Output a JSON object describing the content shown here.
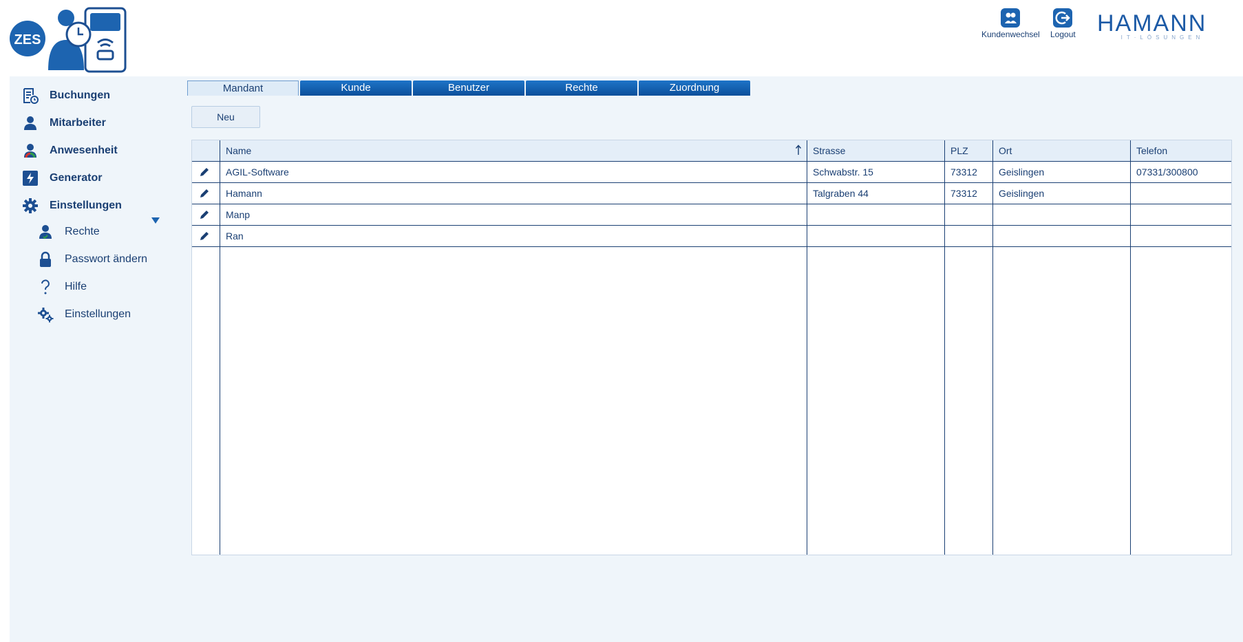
{
  "header": {
    "logo_text": "ZES",
    "kundenwechsel_label": "Kundenwechsel",
    "logout_label": "Logout",
    "brand_name": "HAMANN",
    "brand_sub": "IT·LÖSUNGEN"
  },
  "sidebar": {
    "items": [
      {
        "label": "Buchungen",
        "icon": "bookings-icon"
      },
      {
        "label": "Mitarbeiter",
        "icon": "person-icon"
      },
      {
        "label": "Anwesenheit",
        "icon": "presence-icon"
      },
      {
        "label": "Generator",
        "icon": "lightning-icon"
      },
      {
        "label": "Einstellungen",
        "icon": "gear-icon"
      }
    ],
    "subitems": [
      {
        "label": "Rechte",
        "icon": "person-check-icon"
      },
      {
        "label": "Passwort ändern",
        "icon": "lock-icon"
      },
      {
        "label": "Hilfe",
        "icon": "question-icon"
      },
      {
        "label": "Einstellungen",
        "icon": "gears-icon"
      }
    ]
  },
  "tabs": [
    {
      "label": "Mandant",
      "active": true
    },
    {
      "label": "Kunde",
      "active": false
    },
    {
      "label": "Benutzer",
      "active": false
    },
    {
      "label": "Rechte",
      "active": false
    },
    {
      "label": "Zuordnung",
      "active": false
    }
  ],
  "toolbar": {
    "new_label": "Neu"
  },
  "table": {
    "columns": [
      "Name",
      "Strasse",
      "PLZ",
      "Ort",
      "Telefon"
    ],
    "sort_column": "Name",
    "sort_direction": "ascending",
    "rows": [
      [
        "AGIL-Software",
        "Schwabstr. 15",
        "73312",
        "Geislingen",
        "07331/300800"
      ],
      [
        "Hamann",
        "Talgraben 44",
        "73312",
        "Geislingen",
        ""
      ],
      [
        "Manp",
        "",
        "",
        "",
        ""
      ],
      [
        "Ran",
        "",
        "",
        "",
        ""
      ]
    ]
  },
  "colors": {
    "primary": "#1a3f73",
    "accent": "#1d64b0",
    "background": "#eff5fa",
    "header_bg": "#e4eef8"
  }
}
